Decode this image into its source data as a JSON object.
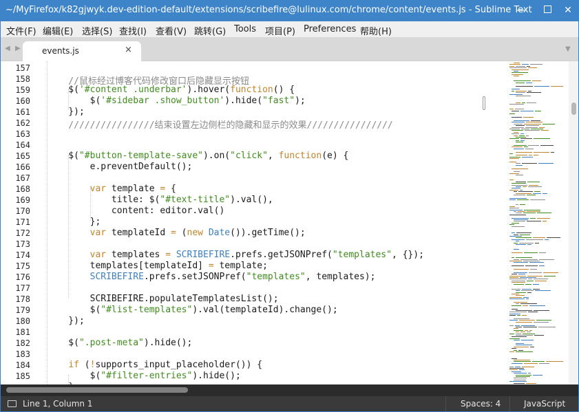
{
  "window": {
    "title": "~/MyFirefox/k82gjwyk.dev-edition-default/extensions/scribefire@lulinux.com/chrome/content/events.js - Sublime Text",
    "minimize_icon": "minimize-icon",
    "maximize_icon": "maximize-icon",
    "close_icon": "close-icon",
    "minimize_glyph": "—",
    "close_glyph": "✕"
  },
  "menu": [
    "文件(F)",
    "编辑(E)",
    "选择(S)",
    "查找(I)",
    "查看(V)",
    "跳转(G)",
    "Tools",
    "项目(P)",
    "Preferences",
    "帮助(H)"
  ],
  "tabs": {
    "nav_left_glyph": "◀",
    "nav_right_glyph": "▶",
    "active_tab": "events.js",
    "close_glyph": "×",
    "dropdown_glyph": "▼"
  },
  "editor": {
    "lines": [
      {
        "n": "157",
        "tokens": []
      },
      {
        "n": "158",
        "tokens": [
          {
            "t": "    //鼠标经过博客代码修改窗口后隐藏显示按钮",
            "c": "comment"
          }
        ]
      },
      {
        "n": "159",
        "tokens": [
          {
            "t": "    $(",
            "c": "ident"
          },
          {
            "t": "'#content .underbar'",
            "c": "string"
          },
          {
            "t": ").hover(",
            "c": "ident"
          },
          {
            "t": "function",
            "c": "keyword"
          },
          {
            "t": "() {",
            "c": "ident"
          }
        ]
      },
      {
        "n": "160",
        "tokens": [
          {
            "t": "        $(",
            "c": "ident"
          },
          {
            "t": "'#sidebar .show_button'",
            "c": "string"
          },
          {
            "t": ").hide(",
            "c": "ident"
          },
          {
            "t": "\"fast\"",
            "c": "string"
          },
          {
            "t": ");",
            "c": "ident"
          }
        ]
      },
      {
        "n": "161",
        "tokens": [
          {
            "t": "    });",
            "c": "ident"
          }
        ]
      },
      {
        "n": "162",
        "tokens": [
          {
            "t": "    ////////////////结束设置左边侧栏的隐藏和显示的效果////////////////",
            "c": "comment"
          }
        ]
      },
      {
        "n": "163",
        "tokens": []
      },
      {
        "n": "164",
        "tokens": []
      },
      {
        "n": "165",
        "tokens": [
          {
            "t": "    $(",
            "c": "ident"
          },
          {
            "t": "\"#button-template-save\"",
            "c": "string"
          },
          {
            "t": ").on(",
            "c": "ident"
          },
          {
            "t": "\"click\"",
            "c": "string"
          },
          {
            "t": ", ",
            "c": "ident"
          },
          {
            "t": "function",
            "c": "keyword"
          },
          {
            "t": "(e) {",
            "c": "ident"
          }
        ]
      },
      {
        "n": "166",
        "tokens": [
          {
            "t": "        e.preventDefault();",
            "c": "ident"
          }
        ]
      },
      {
        "n": "167",
        "tokens": []
      },
      {
        "n": "168",
        "tokens": [
          {
            "t": "        ",
            "c": "ident"
          },
          {
            "t": "var",
            "c": "keyword"
          },
          {
            "t": " template ",
            "c": "ident"
          },
          {
            "t": "=",
            "c": "keyword"
          },
          {
            "t": " {",
            "c": "ident"
          }
        ]
      },
      {
        "n": "169",
        "tokens": [
          {
            "t": "            title: $(",
            "c": "ident"
          },
          {
            "t": "\"#text-title\"",
            "c": "string"
          },
          {
            "t": ").val(),",
            "c": "ident"
          }
        ]
      },
      {
        "n": "170",
        "tokens": [
          {
            "t": "            content: editor.val()",
            "c": "ident"
          }
        ]
      },
      {
        "n": "171",
        "tokens": [
          {
            "t": "        };",
            "c": "ident"
          }
        ]
      },
      {
        "n": "172",
        "tokens": [
          {
            "t": "        ",
            "c": "ident"
          },
          {
            "t": "var",
            "c": "keyword"
          },
          {
            "t": " templateId ",
            "c": "ident"
          },
          {
            "t": "=",
            "c": "keyword"
          },
          {
            "t": " (",
            "c": "ident"
          },
          {
            "t": "new",
            "c": "keyword"
          },
          {
            "t": " ",
            "c": "ident"
          },
          {
            "t": "Date",
            "c": "builtin"
          },
          {
            "t": "()).getTime();",
            "c": "ident"
          }
        ]
      },
      {
        "n": "173",
        "tokens": []
      },
      {
        "n": "174",
        "tokens": [
          {
            "t": "        ",
            "c": "ident"
          },
          {
            "t": "var",
            "c": "keyword"
          },
          {
            "t": " templates ",
            "c": "ident"
          },
          {
            "t": "=",
            "c": "keyword"
          },
          {
            "t": " ",
            "c": "ident"
          },
          {
            "t": "SCRIBEFIRE",
            "c": "builtin"
          },
          {
            "t": ".prefs.getJSONPref(",
            "c": "ident"
          },
          {
            "t": "\"templates\"",
            "c": "string"
          },
          {
            "t": ", {});",
            "c": "ident"
          }
        ]
      },
      {
        "n": "175",
        "tokens": [
          {
            "t": "        templates[templateId] ",
            "c": "ident"
          },
          {
            "t": "=",
            "c": "keyword"
          },
          {
            "t": " template;",
            "c": "ident"
          }
        ]
      },
      {
        "n": "176",
        "tokens": [
          {
            "t": "        ",
            "c": "ident"
          },
          {
            "t": "SCRIBEFIRE",
            "c": "builtin"
          },
          {
            "t": ".prefs.setJSONPref(",
            "c": "ident"
          },
          {
            "t": "\"templates\"",
            "c": "string"
          },
          {
            "t": ", templates);",
            "c": "ident"
          }
        ]
      },
      {
        "n": "177",
        "tokens": []
      },
      {
        "n": "178",
        "tokens": [
          {
            "t": "        SCRIBEFIRE.populateTemplatesList();",
            "c": "ident"
          }
        ]
      },
      {
        "n": "179",
        "tokens": [
          {
            "t": "        $(",
            "c": "ident"
          },
          {
            "t": "\"#list-templates\"",
            "c": "string"
          },
          {
            "t": ").val(templateId).change();",
            "c": "ident"
          }
        ]
      },
      {
        "n": "180",
        "tokens": [
          {
            "t": "    });",
            "c": "ident"
          }
        ]
      },
      {
        "n": "181",
        "tokens": []
      },
      {
        "n": "182",
        "tokens": [
          {
            "t": "    $(",
            "c": "ident"
          },
          {
            "t": "\".post-meta\"",
            "c": "string"
          },
          {
            "t": ").hide();",
            "c": "ident"
          }
        ]
      },
      {
        "n": "183",
        "tokens": []
      },
      {
        "n": "184",
        "tokens": [
          {
            "t": "    ",
            "c": "ident"
          },
          {
            "t": "if",
            "c": "keyword"
          },
          {
            "t": " (",
            "c": "ident"
          },
          {
            "t": "!",
            "c": "keyword"
          },
          {
            "t": "supports_input_placeholder()) {",
            "c": "ident"
          }
        ]
      },
      {
        "n": "185",
        "tokens": [
          {
            "t": "        $(",
            "c": "ident"
          },
          {
            "t": "\"#filter-entries\"",
            "c": "string"
          },
          {
            "t": ").hide();",
            "c": "ident"
          }
        ]
      },
      {
        "n": "",
        "tokens": [
          {
            "t": "    }",
            "c": "ident"
          }
        ]
      }
    ]
  },
  "status": {
    "panel_icon": "panel-toggle-icon",
    "position": "Line 1, Column 1",
    "indentation": "Spaces: 4",
    "syntax": "JavaScript"
  },
  "colors": {
    "titlebar": "#3d84c9",
    "comment": "#8a8a8a",
    "string": "#3f8c1d",
    "keyword": "#c08428",
    "builtin": "#3d7fbf",
    "statusbar": "#3a3a3a"
  }
}
